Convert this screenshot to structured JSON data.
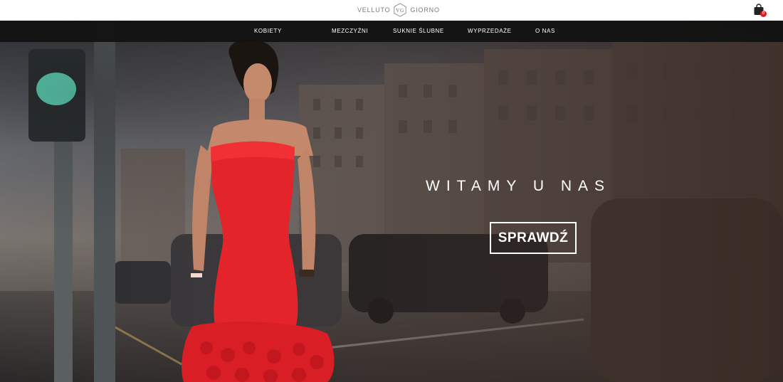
{
  "brand": {
    "left_text": "VELLUTO",
    "monogram": "VG",
    "right_text": "GIORNO"
  },
  "cart": {
    "icon": "shopping-bag-icon",
    "count": "0",
    "badge_color": "#e02020"
  },
  "nav": {
    "items": [
      {
        "label": "KOBIETY"
      },
      {
        "label": "MEZCZYŹNI"
      },
      {
        "label": "SUKNIE ŚLUBNE"
      },
      {
        "label": "WYPRZEDAŻE"
      },
      {
        "label": "O NAS"
      }
    ]
  },
  "hero": {
    "title": "WITAMY U NAS",
    "button_label": "SPRAWDŹ",
    "accent_dress_color": "#e3242b"
  }
}
